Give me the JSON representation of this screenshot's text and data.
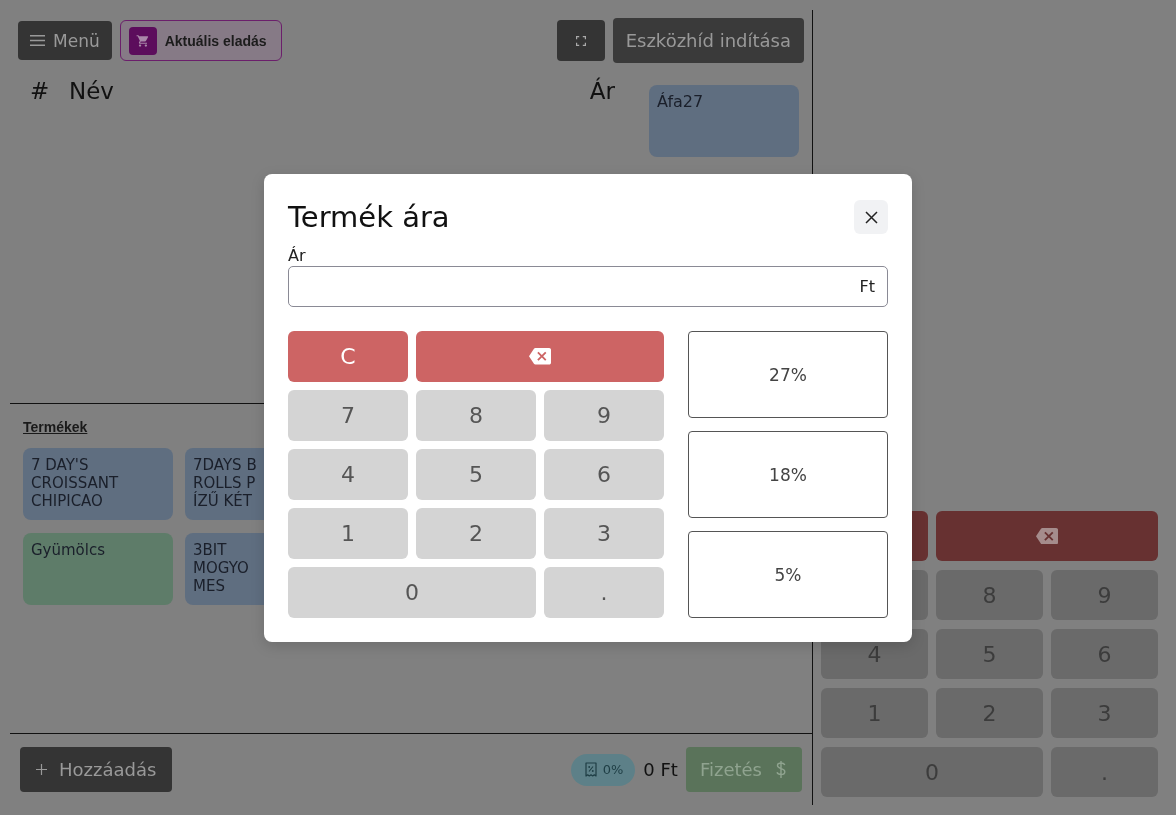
{
  "toolbar": {
    "menu_button": "Menü",
    "sale_tab": {
      "label": "Aktuális eladás",
      "selected": true
    },
    "bridge_button": "Eszközhíd indítása"
  },
  "cart": {
    "columns": [
      "#",
      "Név",
      "Ár"
    ]
  },
  "categories": [
    {
      "name": "Áfa27",
      "color": "#5f6e80"
    }
  ],
  "products": {
    "title": "Termékek",
    "items": [
      {
        "name": "7 DAY'S CROISSANT CHIPICAO",
        "color": "#5f6e80"
      },
      {
        "name": "7DAYS B\nROLLS P\nÍZŰ KÉT",
        "color": "#5f6e80"
      },
      {
        "name": "Gyümölcs",
        "color": "#5e7c69"
      },
      {
        "name": "3BIT\nMOGYO\nMES",
        "color": "#5f6e80"
      }
    ]
  },
  "footer": {
    "add_button": "Hozzáadás",
    "vat_badge": "0%",
    "total": "0 Ft",
    "pay_button": "Fizetés"
  },
  "numpad": {
    "keys": [
      {
        "kind": "clear"
      },
      {
        "kind": "backspace"
      },
      {
        "kind": "digit"
      },
      {
        "kind": "digit",
        "label": "8"
      },
      {
        "kind": "digit",
        "label": "9"
      },
      {
        "kind": "digit",
        "label": "4"
      },
      {
        "kind": "digit",
        "label": "5"
      },
      {
        "kind": "digit",
        "label": "6"
      },
      {
        "kind": "digit",
        "label": "1"
      },
      {
        "kind": "digit",
        "label": "2"
      },
      {
        "kind": "digit",
        "label": "3"
      },
      {
        "kind": "wide_digit",
        "label": "0"
      },
      {
        "kind": "digit",
        "label": "."
      }
    ]
  },
  "modal": {
    "title": "Termék ára",
    "field": {
      "label": "Ár",
      "suffix": "Ft"
    },
    "keys": [
      {
        "kind": "clear",
        "label": "C"
      },
      {
        "kind": "backspace"
      },
      {
        "kind": "digit",
        "label": "7"
      },
      {
        "kind": "digit",
        "label": "8"
      },
      {
        "kind": "digit",
        "label": "9"
      },
      {
        "kind": "digit",
        "label": "4"
      },
      {
        "kind": "digit",
        "label": "5"
      },
      {
        "kind": "digit",
        "label": "6"
      },
      {
        "kind": "digit",
        "label": "1"
      },
      {
        "kind": "digit",
        "label": "2"
      },
      {
        "kind": "digit",
        "label": "3"
      },
      {
        "kind": "wide_digit",
        "label": "0"
      },
      {
        "kind": "digit",
        "label": "."
      }
    ],
    "vat_options": [
      {
        "label": "27%"
      },
      {
        "label": "18%"
      },
      {
        "label": "5%"
      }
    ]
  }
}
